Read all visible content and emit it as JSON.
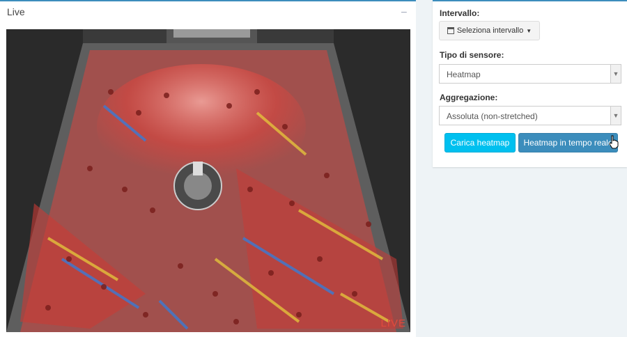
{
  "live_panel": {
    "title": "Live",
    "minimize_symbol": "–",
    "video_overlay_label": "LIVE"
  },
  "controls": {
    "interval": {
      "label": "Intervallo:",
      "button_label": "Seleziona intervallo",
      "icon": "calendar-icon"
    },
    "sensor_type": {
      "label": "Tipo di sensore:",
      "selected": "Heatmap"
    },
    "aggregation": {
      "label": "Aggregazione:",
      "selected": "Assoluta (non-stretched)"
    },
    "buttons": {
      "load_heatmap": "Carica heatmap",
      "realtime_heatmap": "Heatmap in tempo reale"
    }
  },
  "colors": {
    "accent": "#3c8dbc",
    "info": "#00c0ef",
    "heat_red": "#d9463f",
    "heat_yellow": "#e3c23c",
    "heat_blue": "#3a7bd5"
  }
}
